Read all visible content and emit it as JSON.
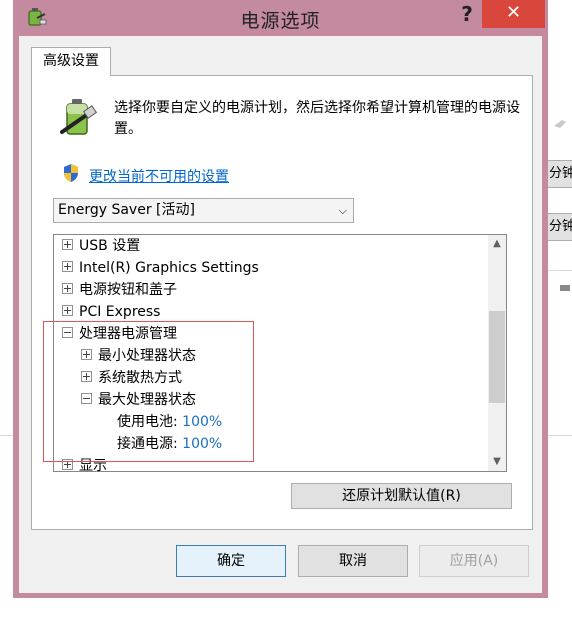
{
  "window": {
    "title": "电源选项",
    "help_label": "?",
    "close_label": "✕"
  },
  "tab": {
    "label": "高级设置"
  },
  "intro": {
    "text": "选择你要自定义的电源计划，然后选择你希望计算机管理的电源设置。"
  },
  "change_link": "更改当前不可用的设置",
  "plan_select": {
    "value": "Energy Saver [活动]"
  },
  "tree": {
    "items": [
      {
        "label": "USB 设置",
        "expander": "plus"
      },
      {
        "label": "Intel(R) Graphics Settings",
        "expander": "plus"
      },
      {
        "label": "电源按钮和盖子",
        "expander": "plus"
      },
      {
        "label": "PCI Express",
        "expander": "plus"
      },
      {
        "label": "处理器电源管理",
        "expander": "minus"
      },
      {
        "label": "最小处理器状态",
        "expander": "plus"
      },
      {
        "label": "系统散热方式",
        "expander": "plus"
      },
      {
        "label": "最大处理器状态",
        "expander": "minus"
      },
      {
        "label": "使用电池:",
        "value": "100%"
      },
      {
        "label": "接通电源:",
        "value": "100%"
      },
      {
        "label": "显示",
        "expander": "plus"
      }
    ]
  },
  "buttons": {
    "restore": "还原计划默认值(R)",
    "ok": "确定",
    "cancel": "取消",
    "apply": "应用(A)"
  },
  "background": {
    "btn1": "分钟",
    "btn2": "分钟"
  },
  "colors": {
    "frame": "#c48aa0",
    "close": "#d9463b",
    "link": "#0066cc",
    "value": "#1a6fc2",
    "highlight_box": "#e05555"
  },
  "icons": [
    "power-options-icon",
    "battery-plug-icon",
    "uac-shield-icon",
    "chevron-down-icon",
    "scroll-up-icon",
    "scroll-down-icon"
  ]
}
